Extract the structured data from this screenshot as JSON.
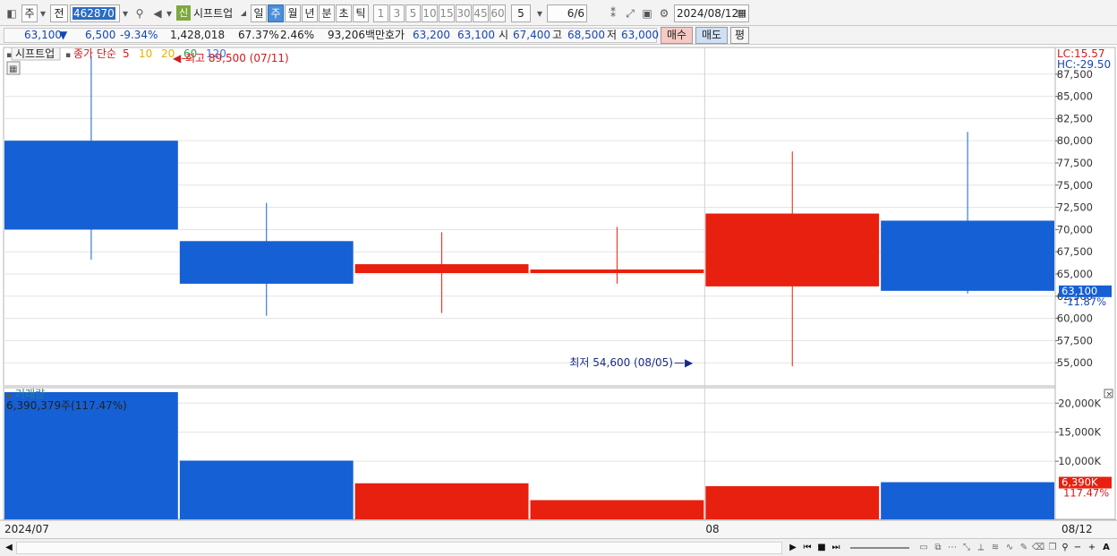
{
  "toolbar": {
    "market": "주",
    "market_type": "전",
    "code": "462870",
    "sin_badge": "신",
    "stock_name": "시프트업",
    "period_tabs": [
      "일",
      "주",
      "월",
      "년",
      "분",
      "초",
      "틱"
    ],
    "active_period": "주",
    "interval_buttons": [
      "1",
      "3",
      "5",
      "10",
      "15",
      "30",
      "45",
      "60"
    ],
    "interval_value": "5",
    "page_indicator": "6/6",
    "date": "2024/08/12"
  },
  "quote": {
    "price": "63,100",
    "change_arrow": "▼",
    "change": "6,500",
    "change_rate": "-9.34%",
    "volume": "1,428,018",
    "volume_ratio": "67.37%",
    "turnover": "2.46%",
    "amount": "93,206백만",
    "ask_label": "호가",
    "ask": "63,200",
    "bid": "63,100",
    "open_label": "시",
    "open": "67,400",
    "high_label": "고",
    "high": "68,500",
    "low_label": "저",
    "low": "63,000",
    "buy_button": "매수",
    "sell_button": "매도",
    "eval_button": "평"
  },
  "colors": {
    "up": "#e8200f",
    "down": "#1560d4",
    "grid": "#e3e3e3",
    "axis_text": "#333333"
  },
  "chart_data": {
    "type": "candlestick",
    "price_panel": {
      "legend_name": "시프트업",
      "legend_ma_label": "종가 단순",
      "ma_periods": [
        "5",
        "10",
        "20",
        "60",
        "120"
      ],
      "ma_colors": [
        "#d21a1a",
        "#e8b000",
        "#e8b000",
        "#2f9a55",
        "#3a6fd8"
      ],
      "lc_label": "LC:15.57",
      "hc_label": "HC:-29.50",
      "y_ticks": [
        "87,500",
        "85,000",
        "82,500",
        "80,000",
        "77,500",
        "75,000",
        "72,500",
        "70,000",
        "67,500",
        "65,000",
        "62,500",
        "60,000",
        "57,500",
        "55,000"
      ],
      "y_tick_values": [
        87500,
        85000,
        82500,
        80000,
        77500,
        75000,
        72500,
        70000,
        67500,
        65000,
        62500,
        60000,
        57500,
        55000
      ],
      "ylim": [
        52400,
        90500
      ],
      "candles": [
        {
          "open": 80000,
          "high": 89500,
          "low": 66600,
          "close": 70000
        },
        {
          "open": 68700,
          "high": 73000,
          "low": 60300,
          "close": 63900
        },
        {
          "open": 65100,
          "high": 69700,
          "low": 60600,
          "close": 66100
        },
        {
          "open": 65100,
          "high": 70300,
          "low": 63900,
          "close": 65500
        },
        {
          "open": 63600,
          "high": 78800,
          "low": 54600,
          "close": 71800
        },
        {
          "open": 71000,
          "high": 81000,
          "low": 62800,
          "close": 63100
        }
      ],
      "high_annotation": "최고 89,500 (07/11)",
      "low_annotation": "최저 54,600 (08/05)",
      "current_price_label": "63,100",
      "current_rate_label": "-11.87%"
    },
    "volume_panel": {
      "title": "거래량",
      "info": "6,390,379주(117.47%)",
      "y_ticks": [
        "20,000K",
        "15,000K",
        "10,000K"
      ],
      "y_tick_values": [
        20000,
        15000,
        10000
      ],
      "ylim": [
        0,
        22200
      ],
      "values": [
        21900,
        10100,
        6200,
        3300,
        5700,
        6390
      ],
      "current_label": "6,390K",
      "current_rate_label": "117.47%"
    },
    "x_labels": [
      {
        "text": "2024/07",
        "index": 0
      },
      {
        "text": "08",
        "index": 4
      },
      {
        "text": "08/12",
        "index": 6
      }
    ]
  }
}
